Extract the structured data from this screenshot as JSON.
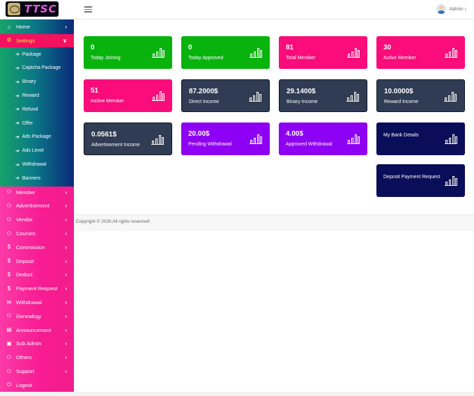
{
  "brand": {
    "logo_text": "TTSC"
  },
  "header": {
    "user_name": "Admin"
  },
  "sidebar": {
    "items": [
      {
        "label": "Home",
        "icon": "home-icon"
      },
      {
        "label": "Settings",
        "icon": "gear-icon"
      },
      {
        "label": "Member",
        "icon": "users-icon"
      },
      {
        "label": "Advertisement",
        "icon": "users-icon"
      },
      {
        "label": "Vendor",
        "icon": "users-icon"
      },
      {
        "label": "Courses",
        "icon": "users-icon"
      },
      {
        "label": "Commission",
        "icon": "dollar-icon"
      },
      {
        "label": "Deposit",
        "icon": "dollar-icon"
      },
      {
        "label": "Deduct",
        "icon": "dollar-icon"
      },
      {
        "label": "Payment Request",
        "icon": "dollar-icon"
      },
      {
        "label": "Withdrawal",
        "icon": "envelope-icon"
      },
      {
        "label": "Genealogy",
        "icon": "users-icon"
      },
      {
        "label": "Announcement",
        "icon": "money-icon"
      },
      {
        "label": "Sub Admin",
        "icon": "id-card-icon"
      },
      {
        "label": "Others",
        "icon": "users-icon"
      },
      {
        "label": "Support",
        "icon": "users-icon"
      },
      {
        "label": "Logout",
        "icon": "power-icon"
      }
    ],
    "settings_subitems": [
      "Package",
      "Captcha Package",
      "Binary",
      "Reward",
      "Refund",
      "Offer",
      "Ads Package",
      "Ads Level",
      "Withdrawal",
      "Banners"
    ]
  },
  "cards": [
    {
      "value": "0",
      "label": "Today Joining",
      "color": "#08b30e"
    },
    {
      "value": "0",
      "label": "Today Approved",
      "color": "#08b30e"
    },
    {
      "value": "81",
      "label": "Total Member",
      "color": "#fa0d7a"
    },
    {
      "value": "30",
      "label": "Active Member",
      "color": "#fa0d7a"
    },
    {
      "value": "51",
      "label": "Inctive Member",
      "color": "#fa0d7a"
    },
    {
      "value": "87.2000$",
      "label": "Direct Income",
      "color": "#2f3c53"
    },
    {
      "value": "29.1400$",
      "label": "Binary Income",
      "color": "#2f3c53"
    },
    {
      "value": "10.0000$",
      "label": "Reward Income",
      "color": "#2f3c53"
    },
    {
      "value": "0.0561$",
      "label": "Advertisement Income",
      "color": "#2f3c53"
    },
    {
      "value": "20.00$",
      "label": "Pending Withdrawal",
      "color": "#8e00f4"
    },
    {
      "value": "4.00$",
      "label": "Approved Withdrawal",
      "color": "#8e00f4"
    },
    {
      "value": "",
      "label": "My Bank Details",
      "color": "#0a0d57"
    },
    {
      "value": "",
      "label": "Deposit Payment Request",
      "color": "#0a0d57"
    }
  ],
  "footer": {
    "text": "Copyright © 2026 All rights reserved!"
  }
}
